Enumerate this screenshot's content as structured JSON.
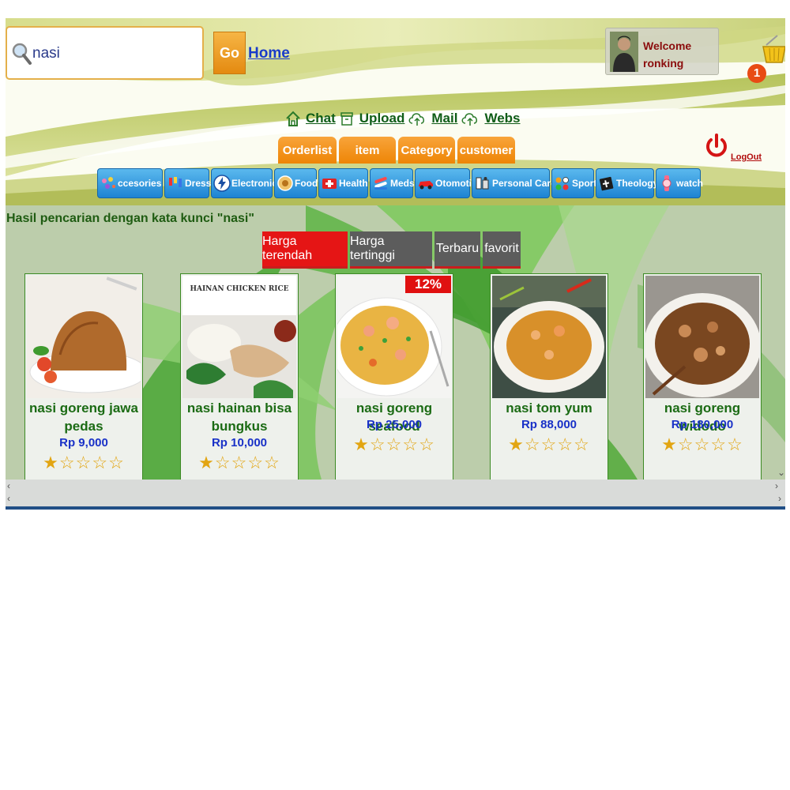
{
  "search": {
    "value": "nasi",
    "go_label": "Go",
    "home_label": "Home"
  },
  "user": {
    "welcome": "Welcome",
    "name": "ronking"
  },
  "cart": {
    "count": "1"
  },
  "top_links": [
    {
      "label": "Chat",
      "icon": "home-icon"
    },
    {
      "label": "Upload",
      "icon": "archive-box-icon"
    },
    {
      "label": "Mail",
      "icon": "cloud-upload-icon"
    },
    {
      "label": "Webs",
      "icon": "cloud-upload-icon"
    }
  ],
  "admin_tabs": [
    "Orderlist",
    "item",
    "Category",
    "customer"
  ],
  "logout_label": "LogOut",
  "categories": [
    {
      "label": "ccesories",
      "icon": "accessories-icon"
    },
    {
      "label": "Dress",
      "icon": "dress-icon"
    },
    {
      "label": "Electronic",
      "icon": "lightning-icon"
    },
    {
      "label": "Food",
      "icon": "food-icon"
    },
    {
      "label": "Health",
      "icon": "first-aid-icon"
    },
    {
      "label": "Meds",
      "icon": "meds-icon"
    },
    {
      "label": "Otomotif",
      "icon": "car-icon"
    },
    {
      "label": "Personal Care",
      "icon": "personal-care-icon"
    },
    {
      "label": "Sport",
      "icon": "sport-balls-icon"
    },
    {
      "label": "Theology",
      "icon": "bible-icon"
    },
    {
      "label": "watch",
      "icon": "watch-icon"
    }
  ],
  "results": {
    "title": "Hasil pencarian dengan kata kunci \"nasi\"",
    "sort_options": [
      "Harga terendah",
      "Harga tertinggi",
      "Terbaru",
      "favorit"
    ],
    "active_sort": "Harga terendah",
    "products": [
      {
        "name": "nasi goreng jawa pedas",
        "price": "Rp 9,000",
        "rating": 1,
        "rating_max": 5
      },
      {
        "name": "nasi hainan bisa bungkus",
        "price": "Rp 10,000",
        "rating": 1,
        "rating_max": 5,
        "photo_caption": "HAINAN CHICKEN RICE"
      },
      {
        "name": "nasi goreng seafood",
        "price": "Rp 25,000",
        "rating": 1,
        "rating_max": 5,
        "discount": "12%"
      },
      {
        "name": "nasi tom yum",
        "price": "Rp 88,000",
        "rating": 1,
        "rating_max": 5
      },
      {
        "name": "nasi goreng widodo",
        "price": "Rp 180,000",
        "rating": 1,
        "rating_max": 5
      }
    ]
  },
  "colors": {
    "accent_orange": "#ee8506",
    "category_blue": "#1d83d2",
    "active_sort_red": "#e51515",
    "text_green": "#1b6b14",
    "price_blue": "#1931c7"
  }
}
